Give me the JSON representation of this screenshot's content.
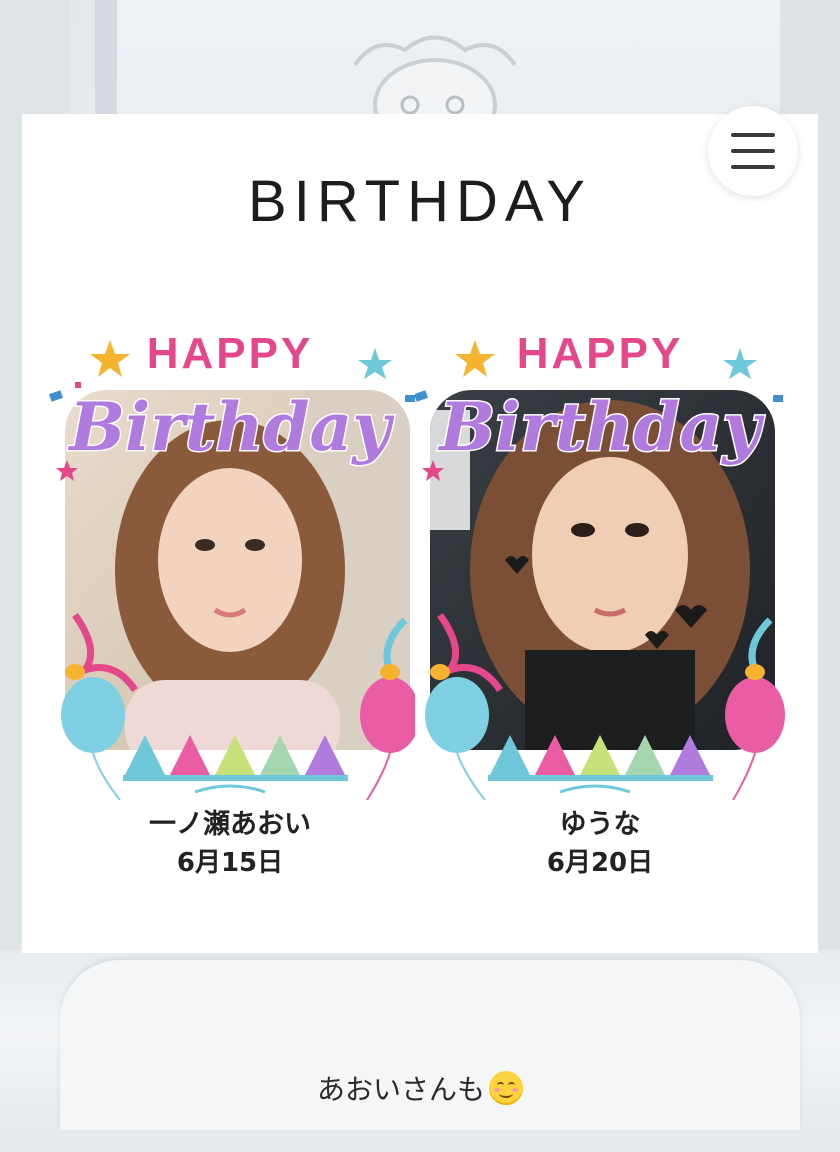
{
  "header": {
    "title": "BIRTHDAY",
    "menu_icon": "hamburger-menu-icon"
  },
  "frame_text": {
    "happy": "HAPPY",
    "birthday": "Birthday"
  },
  "members": [
    {
      "name": "一ノ瀬あおい",
      "birthday": "6月15日"
    },
    {
      "name": "ゆうな",
      "birthday": "6月20日"
    }
  ],
  "caption": {
    "text": "あおいさんも",
    "emoji": "smiling-face-emoji"
  },
  "colors": {
    "title_text": "#1d1d1d",
    "happy_pink": "#e5488a",
    "birthday_purple": "#b07adf",
    "balloon_blue": "#7fd0e3",
    "balloon_pink": "#ea5da5"
  }
}
